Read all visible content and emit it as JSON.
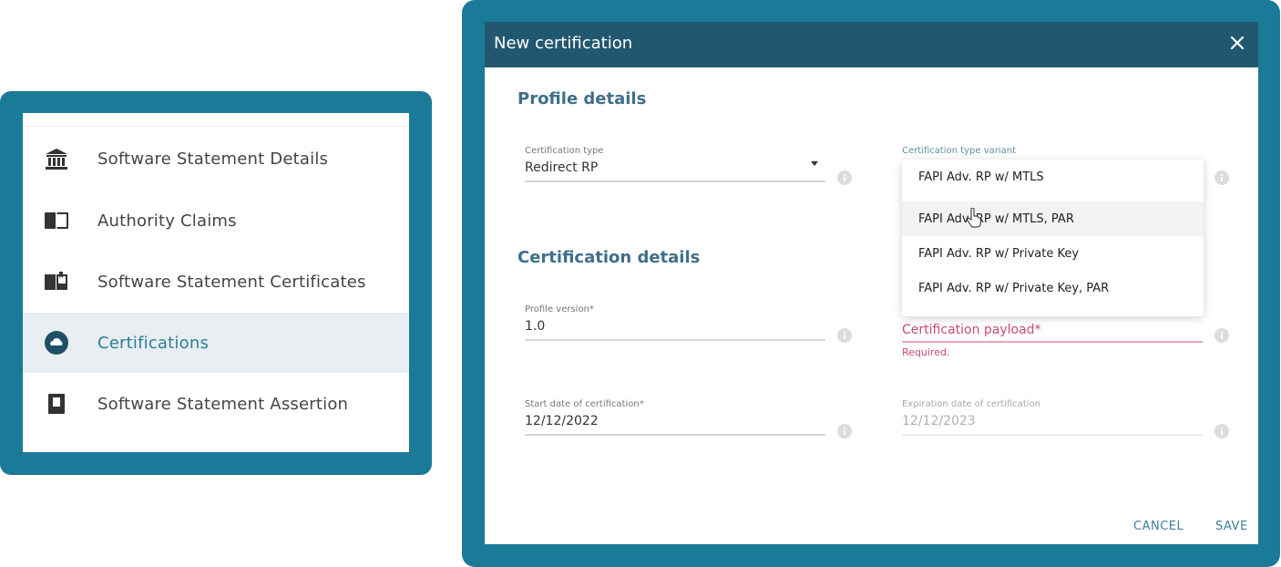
{
  "sidebar": {
    "items": [
      {
        "label": "Software Statement Details",
        "icon": "bank-icon",
        "active": false
      },
      {
        "label": "Authority Claims",
        "icon": "book-open-icon",
        "active": false
      },
      {
        "label": "Software Statement Certificates",
        "icon": "certificate-book-icon",
        "active": false
      },
      {
        "label": "Certifications",
        "icon": "cloud-circle-icon",
        "active": true
      },
      {
        "label": "Software Statement Assertion",
        "icon": "document-icon",
        "active": false
      }
    ]
  },
  "dialog": {
    "title": "New certification",
    "profile_section": "Profile details",
    "certification_section": "Certification details",
    "cert_type": {
      "label": "Certification type",
      "value": "Redirect RP"
    },
    "cert_variant": {
      "label": "Certification type variant",
      "options": [
        "FAPI Adv. RP w/ MTLS",
        "FAPI Adv. RP w/ MTLS, PAR",
        "FAPI Adv. RP w/ Private Key",
        "FAPI Adv. RP w/ Private Key, PAR"
      ],
      "hovered_index": 1
    },
    "profile_version": {
      "label": "Profile version*",
      "value": "1.0"
    },
    "payload": {
      "label": "Certification payload*",
      "helper": "Required."
    },
    "start_date": {
      "label": "Start date of certification*",
      "value": "12/12/2022"
    },
    "expiration_date": {
      "label": "Expiration date of certification",
      "value": "12/12/2023"
    },
    "cancel_label": "CANCEL",
    "save_label": "SAVE"
  },
  "colors": {
    "frame": "#1b7a97",
    "header": "#22586f",
    "accent": "#3f7f99",
    "error": "#c94b6e",
    "active_bg": "#e8eef2"
  }
}
